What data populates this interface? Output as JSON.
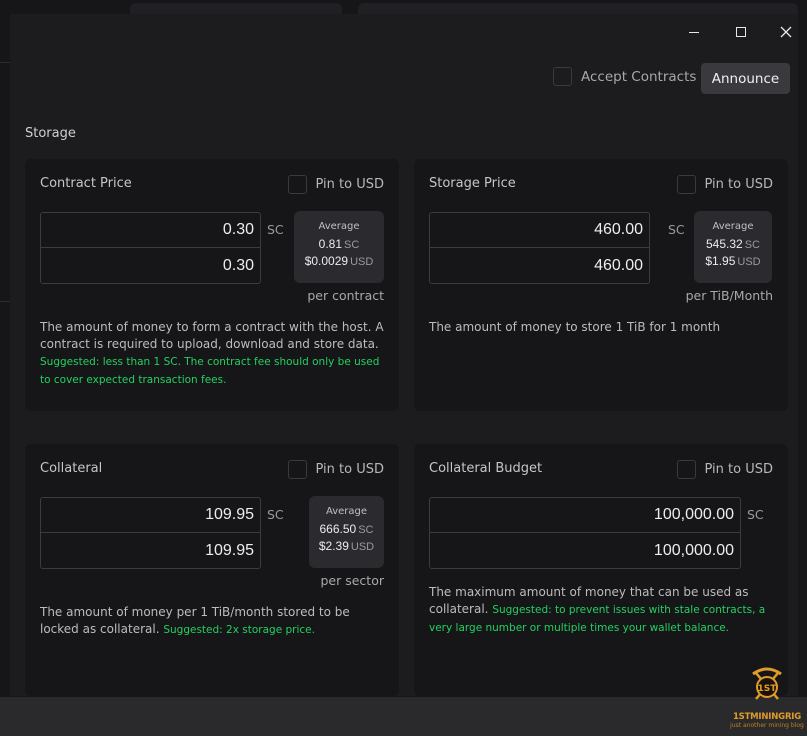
{
  "window": {
    "minimize_icon": "minimize-icon",
    "maximize_icon": "maximize-icon",
    "close_icon": "close-icon"
  },
  "toolbar": {
    "accept_label": "Accept Contracts",
    "announce_label": "Announce"
  },
  "section": {
    "title": "Storage"
  },
  "pin_label": "Pin to USD",
  "average_label": "Average",
  "cards": {
    "contract_price": {
      "title": "Contract Price",
      "value_sc": "0.30",
      "value_usd": "0.30",
      "unit": "SC",
      "avg_sc": "0.81",
      "avg_usd": "$0.0029",
      "avg_sc_unit": "SC",
      "avg_usd_unit": "USD",
      "per": "per contract",
      "description": "The amount of money to form a contract with the host. A contract is required to upload, download and store data.",
      "suggested": "Suggested: less than 1 SC. The contract fee should only be used to cover expected transaction fees."
    },
    "storage_price": {
      "title": "Storage Price",
      "value_sc": "460.00",
      "value_usd": "460.00",
      "unit": "SC",
      "avg_sc": "545.32",
      "avg_usd": "$1.95",
      "avg_sc_unit": "SC",
      "avg_usd_unit": "USD",
      "per": "per TiB/Month",
      "description": "The amount of money to store 1 TiB for 1 month"
    },
    "collateral": {
      "title": "Collateral",
      "value_sc": "109.95",
      "value_usd": "109.95",
      "unit": "SC",
      "avg_sc": "666.50",
      "avg_usd": "$2.39",
      "avg_sc_unit": "SC",
      "avg_usd_unit": "USD",
      "per": "per sector",
      "description": "The amount of money per 1 TiB/month stored to be locked as collateral.",
      "suggested": "Suggested: 2x storage price."
    },
    "collateral_budget": {
      "title": "Collateral Budget",
      "value_sc": "100,000.00",
      "value_usd": "100,000.00",
      "unit": "SC",
      "description": "The maximum amount of money that can be used as collateral.",
      "suggested": "Suggested: to prevent issues with stale contracts, a very large number or multiple times your wallet balance."
    }
  },
  "watermark": {
    "logo_text": "1ST",
    "name": "1STMININGRIG",
    "tagline": "just another mining blog",
    "accent": "#e09c2a"
  }
}
